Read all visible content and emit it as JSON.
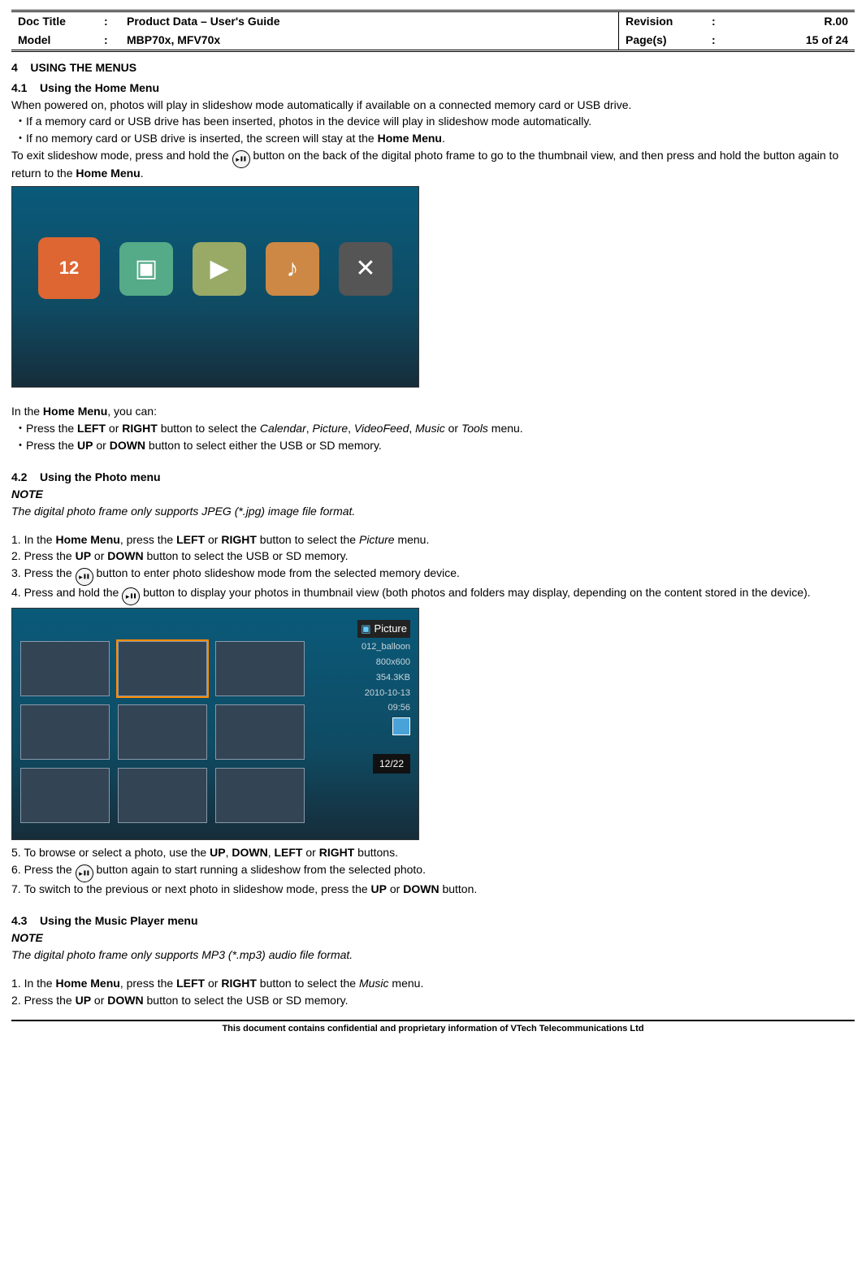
{
  "header": {
    "docTitleLabel": "Doc Title",
    "docTitle": "Product Data – User's Guide",
    "modelLabel": "Model",
    "model": "MBP70x, MFV70x",
    "revisionLabel": "Revision",
    "revision": "R.00",
    "pagesLabel": "Page(s)",
    "pages": "15 of 24",
    "colon": ":"
  },
  "section4": {
    "num": "4",
    "title": "USING THE MENUS"
  },
  "section41": {
    "num": "4.1",
    "title": "Using the Home Menu",
    "intro": "When powered on, photos will play in slideshow mode automatically if available on a connected memory card or USB drive.",
    "b1": "・If a memory card or USB drive has been inserted, photos in the device will play in slideshow mode automatically.",
    "b2_pre": "・If no memory card or USB drive is inserted, the screen will stay at the ",
    "b2_bold": "Home Menu",
    "b2_post": ".",
    "exit_pre": "To exit slideshow mode, press and hold the ",
    "exit_mid": " button on the back of the digital photo frame to go to the thumbnail view, and then press and hold the button again to return to the ",
    "exit_bold": "Home Menu",
    "exit_post": ".",
    "inmenu_pre": "In the ",
    "inmenu_bold": "Home Menu",
    "inmenu_post": ", you can:",
    "hb1_a": "・Press the ",
    "hb1_left": "LEFT",
    "hb1_or": " or ",
    "hb1_right": "RIGHT",
    "hb1_b": " button to select the ",
    "hb1_m1": "Calendar",
    "hb1_c1": ", ",
    "hb1_m2": "Picture",
    "hb1_c2": ", ",
    "hb1_m3": "VideoFeed",
    "hb1_c3": ", ",
    "hb1_m4": "Music",
    "hb1_or2": " or ",
    "hb1_m5": "Tools",
    "hb1_end": " menu.",
    "hb2_a": "・Press the ",
    "hb2_up": "UP",
    "hb2_or": " or ",
    "hb2_down": "DOWN",
    "hb2_b": " button to select either the USB or SD memory."
  },
  "section42": {
    "num": "4.2",
    "title": "Using the Photo menu",
    "noteLabel": "NOTE",
    "noteText": "The digital photo frame only supports JPEG (*.jpg) image file format.",
    "s1_a": "1.  In the ",
    "s1_hm": "Home Menu",
    "s1_b": ", press the ",
    "s1_left": "LEFT",
    "s1_or": " or ",
    "s1_right": "RIGHT",
    "s1_c": " button to select the ",
    "s1_pic": "Picture",
    "s1_end": " menu.",
    "s2_a": "2.  Press the ",
    "s2_up": "UP",
    "s2_or": " or ",
    "s2_down": "DOWN",
    "s2_b": " button to select the USB or SD memory.",
    "s3_a": "3.  Press the ",
    "s3_b": " button to enter photo slideshow mode from the selected memory device.",
    "s4_a": "4.  Press and hold the ",
    "s4_b": " button to display your photos in thumbnail view (both photos and folders may display, depending on the content stored in the device).",
    "s5_a": "5.  To browse or select a photo, use the ",
    "s5_up": "UP",
    "s5_c1": ", ",
    "s5_down": "DOWN",
    "s5_c2": ", ",
    "s5_left": "LEFT",
    "s5_or": " or ",
    "s5_right": "RIGHT",
    "s5_end": " buttons.",
    "s6_a": "6.  Press the ",
    "s6_b": " button again to start running a slideshow from the selected photo.",
    "s7_a": "7.  To switch to the previous or next photo in slideshow mode, press the ",
    "s7_up": "UP",
    "s7_or": " or ",
    "s7_down": "DOWN",
    "s7_end": " button."
  },
  "section43": {
    "num": "4.3",
    "title": "Using the Music Player menu",
    "noteLabel": "NOTE",
    "noteText": "The digital photo frame only supports MP3 (*.mp3) audio file format.",
    "s1_a": "1.  In the ",
    "s1_hm": "Home Menu",
    "s1_b": ", press the ",
    "s1_left": "LEFT",
    "s1_or": " or ",
    "s1_right": "RIGHT",
    "s1_c": " button to select the ",
    "s1_music": "Music",
    "s1_end": " menu.",
    "s2_a": "2.  Press the ",
    "s2_up": "UP",
    "s2_or": " or ",
    "s2_down": "DOWN",
    "s2_b": " button to select the USB or SD memory."
  },
  "fig1": {
    "labels": [
      "Calendar",
      "Picture",
      "VideoFeed",
      "Music",
      "Tools"
    ],
    "calDay": "12"
  },
  "fig2": {
    "panelTitle": "Picture",
    "fileName": "012_balloon",
    "resolution": "800x600",
    "fileSize": "354.3KB",
    "date": "2010-10-13",
    "time": "09:56",
    "counter": "12/22"
  },
  "footer": "This document contains confidential and proprietary information of VTech Telecommunications Ltd"
}
